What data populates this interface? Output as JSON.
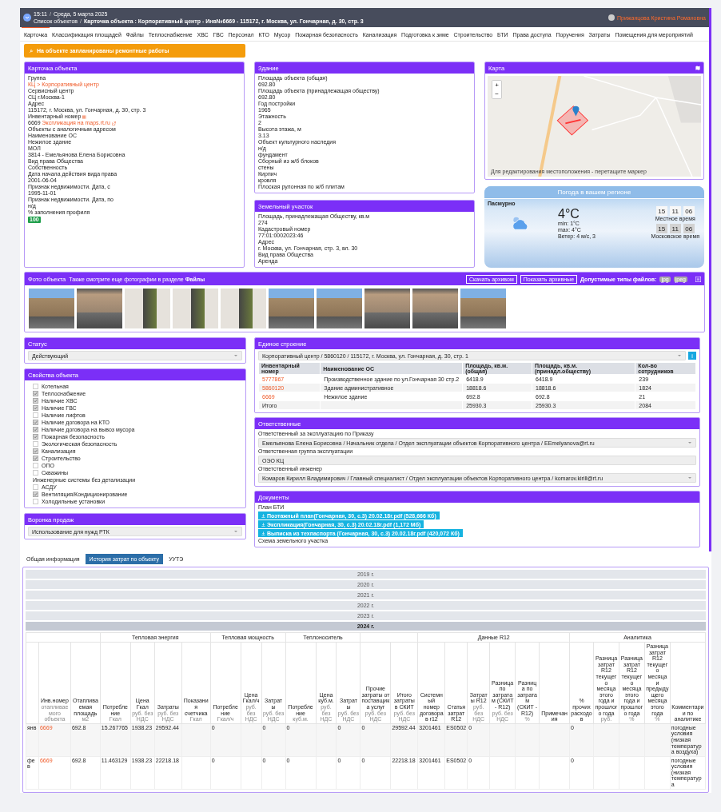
{
  "header": {
    "time": "15:11",
    "separator": "/",
    "date": "Среда, 5 марта 2025",
    "breadcrumbs": [
      "Список объектов",
      "Карточка объекта : Корпоративный центр - Инв№6669 - 115172, г. Москва, ул. Гончарная, д. 30, стр. 3"
    ],
    "user": "Прижанцова Кристина Романовна"
  },
  "tabs": [
    {
      "label": "Карточка",
      "selected": true
    },
    {
      "label": "Классификация площадей",
      "selected": false
    },
    {
      "label": "Файлы",
      "selected": false
    },
    {
      "label": "Теплоснабжение",
      "selected": false
    },
    {
      "label": "ХВС",
      "selected": false
    },
    {
      "label": "ГВС",
      "selected": false
    },
    {
      "label": "Персонал",
      "selected": false
    },
    {
      "label": "КТО",
      "selected": false
    },
    {
      "label": "Мусор",
      "selected": false
    },
    {
      "label": "Пожарная безопасность",
      "selected": false
    },
    {
      "label": "Канализация",
      "selected": false
    },
    {
      "label": "Подготовка к зиме",
      "selected": false
    },
    {
      "label": "Строительство",
      "selected": false
    },
    {
      "label": "БТИ",
      "selected": false
    },
    {
      "label": "Права доступа",
      "selected": false
    },
    {
      "label": "Поручения",
      "selected": false
    },
    {
      "label": "Затраты",
      "selected": false
    },
    {
      "label": "Помещения для мероприятий",
      "selected": false
    }
  ],
  "alert": "На объекте запланированы ремонтные работы",
  "object_card": {
    "title": "Карточка объекта",
    "fields": [
      {
        "label": "Группа",
        "value": "КЦ > Корпоративный центр",
        "kind": "link"
      },
      {
        "label": "Сервисный центр",
        "value": "СЦ г.Москва-1",
        "kind": "text"
      },
      {
        "label": "Адрес",
        "value": "115172, г. Москва, ул. Гончарная, д. 30, стр. 3",
        "kind": "text"
      },
      {
        "label": "Инвентарный номер",
        "value": "6669",
        "link": "Экспликация на maps.rt.ru",
        "kind": "inventory"
      },
      {
        "label": "Объекты с аналогичным адресом",
        "kind": "text"
      },
      {
        "label": "Наименование ОС",
        "value": "Нежилое здание",
        "kind": "text"
      },
      {
        "label": "МОЛ",
        "value": "3814 - Емельянова Елена Борисовна",
        "kind": "text"
      },
      {
        "label": "Вид права Общества",
        "value": "Собственность",
        "kind": "text"
      },
      {
        "label": "Дата начала действия вида права",
        "value": "2001-06-04",
        "kind": "text"
      },
      {
        "label": "Признак недвижимости. Дата, с",
        "value": "1995-11-01",
        "kind": "text"
      },
      {
        "label": "Признак недвижимости. Дата, по",
        "value": "н/д",
        "kind": "text"
      },
      {
        "label": "% заполнения профиля",
        "value": "100",
        "kind": "badge"
      }
    ]
  },
  "building": {
    "title": "Здание",
    "fields": [
      {
        "label": "Площадь объекта (общая)",
        "value": "692.80"
      },
      {
        "label": "Площадь объекта (принадлежащая обществу)",
        "value": "692.80"
      },
      {
        "label": "Год постройки",
        "value": "1965"
      },
      {
        "label": "Этажность",
        "value": "2"
      },
      {
        "label": "Высота этажа, м",
        "value": "3.13"
      },
      {
        "label": "Объект культурного наследия",
        "value": "н/д"
      },
      {
        "label": "фундамент",
        "value": "Сборный из ж/б блоков"
      },
      {
        "label": "стены",
        "value": "Кирпич"
      },
      {
        "label": "кровля",
        "value": "Плоская рулонная по ж/б плитам"
      }
    ]
  },
  "land": {
    "title": "Земельный участок",
    "fields": [
      {
        "label": "Площадь, принадлежащая Обществу, кв.м",
        "value": "274"
      },
      {
        "label": "Кадастровый номер",
        "value": "77:01:0002023:46"
      },
      {
        "label": "Адрес",
        "value": "г. Москва, ул. Гончарная, стр. 3, вл. 30"
      },
      {
        "label": "Вид права Общества",
        "value": "Аренда"
      }
    ]
  },
  "map": {
    "title": "Карта",
    "zoom_in": "+",
    "zoom_out": "−",
    "caption": "Для редактирования местоположения - перетащите маркер"
  },
  "weather": {
    "title": "Погода в вашем регионе",
    "condition": "Пасмурно",
    "temperature": "4°C",
    "min": "min: 1°C",
    "max": "max: 4°C",
    "wind": "Ветер: 4 м/с, 3",
    "clocks": [
      {
        "label": "Местное время",
        "digits": [
          "15",
          "11",
          "06"
        ],
        "kind": "local"
      },
      {
        "label": "Московское время",
        "digits": [
          "15",
          "11",
          "06"
        ],
        "kind": "moscow"
      }
    ]
  },
  "photos": {
    "title": "Фото объекта",
    "hint": "Также смотрите еще фотографии в разделе **Файлы**",
    "buttons": [
      "Скачать архивом",
      "Показать архивные"
    ],
    "types_label": "Допустимые типы файлов:",
    "types": [
      "jpg",
      "jpeg"
    ],
    "items": [
      {
        "kind": "facade"
      },
      {
        "kind": "entrance"
      },
      {
        "kind": "stairwell"
      },
      {
        "kind": "stairwell"
      },
      {
        "kind": "stairwell"
      },
      {
        "kind": "facade"
      },
      {
        "kind": "facade"
      },
      {
        "kind": "entrance"
      },
      {
        "kind": "entrance"
      },
      {
        "kind": "facade"
      }
    ]
  },
  "status": {
    "title": "Статус",
    "value": "Действующий"
  },
  "properties": {
    "title": "Свойства объекта",
    "items": [
      {
        "label": "Котельная",
        "kind": "checkbox",
        "checked": false
      },
      {
        "label": "Теплоснабжение",
        "kind": "checkbox",
        "checked": true
      },
      {
        "label": "Наличие ХВС",
        "kind": "checkbox",
        "checked": true
      },
      {
        "label": "Наличие ГВС",
        "kind": "checkbox",
        "checked": true
      },
      {
        "label": "Наличие лифтов",
        "kind": "checkbox",
        "checked": false
      },
      {
        "label": "Наличие договора на КТО",
        "kind": "checkbox",
        "checked": true
      },
      {
        "label": "Наличие договора на вывоз мусора",
        "kind": "checkbox",
        "checked": true
      },
      {
        "label": "Пожарная безопасность",
        "kind": "checkbox",
        "checked": true
      },
      {
        "label": "Экологическая безопасность",
        "kind": "checkbox",
        "checked": false
      },
      {
        "label": "Канализация",
        "kind": "checkbox",
        "checked": true
      },
      {
        "label": "Строительство",
        "kind": "checkbox",
        "checked": true
      },
      {
        "label": "ОПО",
        "kind": "checkbox",
        "checked": false
      },
      {
        "label": "Скважины",
        "kind": "checkbox",
        "checked": false
      },
      {
        "label": "Инженерные системы без детализации",
        "kind": "heading"
      },
      {
        "label": "АСДУ",
        "kind": "checkbox",
        "checked": false
      },
      {
        "label": "Вентиляция/Кондиционирование",
        "kind": "checkbox",
        "checked": true
      },
      {
        "label": "Холодильные установки",
        "kind": "checkbox",
        "checked": false
      }
    ]
  },
  "sales_funnel": {
    "title": "Воронка продаж",
    "value": "Использование для нужд РТК"
  },
  "single_building": {
    "title": "Единое строение",
    "select": "Корпоративный центр / 5860120 / 115172, г. Москва, ул. Гончарная, д. 30, стр. 1",
    "info": "i",
    "columns": [
      "Инвентарный номер",
      "Наименование ОС",
      "Площадь, кв.м. (общая)",
      "Площадь, кв.м. (принадл.обществу)",
      "Кол-во сотрудников"
    ],
    "rows": [
      {
        "kind": "item",
        "cells": [
          "5777867",
          "Производственное здание по ул.Гончарная 30 стр.2",
          "6418.9",
          "6418.9",
          "239"
        ]
      },
      {
        "kind": "item",
        "cells": [
          "5860120",
          "Здание административное",
          "18818.6",
          "18818.6",
          "1824"
        ]
      },
      {
        "kind": "item",
        "cells": [
          "6669",
          "Нежилое здание",
          "692.8",
          "692.8",
          "21"
        ]
      },
      {
        "kind": "total",
        "cells": [
          "Итого",
          "",
          "25930.3",
          "25930.3",
          "2084"
        ]
      }
    ]
  },
  "responsible": {
    "title": "Ответственные",
    "fields": [
      {
        "label": "Ответственный за эксплуатацию по Приказу",
        "value": "Емельянова Елена Борисовна / Начальник отдела / Отдел эксплуатации объектов Корпоративного центра / EEmelyanova@rt.ru",
        "kind": "select"
      },
      {
        "label": "Ответственная группа эксплуатации",
        "value": "ОЭО КЦ",
        "kind": "text"
      },
      {
        "label": "Ответственный инженер",
        "value": "Комаров Кирилл Владимирович / Главный специалист / Отдел эксплуатации объектов Корпоративного центра / komarov.kirill@rt.ru",
        "kind": "select"
      }
    ]
  },
  "documents": {
    "title": "Документы",
    "sections": [
      {
        "label": "План БТИ",
        "files": [
          "Поэтажный план(Гончарная, 30, с.3) 20.02.18г.pdf (528,666 Кб)",
          "Экспликация(Гончарная, 30, с.3) 20.02.18г.pdf (1,172 Мб)",
          "Выписка из техпаспорта (Гончарная, 30, с.3) 20.02.18г.pdf (420,072 Кб)"
        ]
      },
      {
        "label": "Схема земельного участка"
      }
    ]
  },
  "bottom_tabs": [
    {
      "label": "Общая информация",
      "selected": false
    },
    {
      "label": "История затрат по объекту",
      "selected": true
    },
    {
      "label": "УУТЭ",
      "selected": false
    }
  ],
  "years": [
    {
      "label": "2019 г.",
      "expanded": false
    },
    {
      "label": "2020 г.",
      "expanded": false
    },
    {
      "label": "2021 г.",
      "expanded": false
    },
    {
      "label": "2022 г.",
      "expanded": false
    },
    {
      "label": "2023 г.",
      "expanded": false
    },
    {
      "label": "2024 г.",
      "expanded": true
    }
  ],
  "cost_table": {
    "groups": [
      "Тепловая энергия",
      "Тепловая мощность",
      "Теплоноситель",
      "Данные R12",
      "Аналитика"
    ],
    "columns": [
      {},
      {
        "label": "Инв.номер",
        "unit": "отапливаемого объекта"
      },
      {
        "label": "Отапливаемая площадь",
        "unit": "м2"
      },
      {
        "label": "Потребление",
        "unit": "Гкал"
      },
      {
        "label": "Цена Гкал",
        "unit": "руб. без НДС"
      },
      {
        "label": "Затраты",
        "unit": "руб. без НДС"
      },
      {
        "label": "Показания счетчика",
        "unit": "Гкал"
      },
      {
        "label": "Потребление",
        "unit": "Гкал/ч"
      },
      {
        "label": "Цена Гкал/ч",
        "unit": "руб. без НДС"
      },
      {
        "label": "Затраты",
        "unit": "руб. без НДС"
      },
      {
        "label": "Потребление",
        "unit": "куб.м."
      },
      {
        "label": "Цена куб.м.",
        "unit": "руб. без НДС"
      },
      {
        "label": "Затраты",
        "unit": "руб. без НДС"
      },
      {
        "label": "Прочие затраты от поставщика услуг",
        "unit": "руб. без НДС"
      },
      {
        "label": "Итого затраты в СКИТ",
        "unit": "руб. без НДС"
      },
      {
        "label": "Системный номер договора в r12"
      },
      {
        "label": "Статья затрат R12"
      },
      {
        "label": "Затраты R12",
        "unit": "руб. без НДС"
      },
      {
        "label": "Разница по затратам (СКИТ - R12)",
        "unit": "руб. без НДС"
      },
      {
        "label": "Разница по затратам (СКИТ - R12)",
        "unit": "%"
      },
      {
        "label": "Примечания"
      },
      {
        "label": "% прочих расходов"
      },
      {
        "label": "Разница затрат R12 текущего месяца этого года и прошлого года",
        "unit": "руб."
      },
      {
        "label": "Разница затрат R12 текущего месяца этого года и прошлого года",
        "unit": "%"
      },
      {
        "label": "Разница затрат R12 текущего месяца и предыдущего месяца этого года",
        "unit": "%"
      },
      {
        "label": "Комментарии по аналитике"
      }
    ],
    "rows": [
      [
        "янв",
        "6669",
        "692.8",
        "15.267765",
        "1938.23",
        "29592.44",
        "",
        "0",
        "",
        "0",
        "0",
        "",
        "0",
        "0",
        "29592.44",
        "3201461",
        "ES0502",
        "0",
        "",
        "",
        "",
        "0",
        "",
        "",
        "",
        "погодные условия (низкая температура воздуха)"
      ],
      [
        "фев",
        "6669",
        "692.8",
        "11.463129",
        "1938.23",
        "22218.18",
        "",
        "0",
        "",
        "0",
        "0",
        "",
        "0",
        "0",
        "22218.18",
        "3201461",
        "ES0502",
        "0",
        "",
        "",
        "",
        "0",
        "",
        "",
        "",
        "погодные условия (низкая температура"
      ]
    ]
  }
}
